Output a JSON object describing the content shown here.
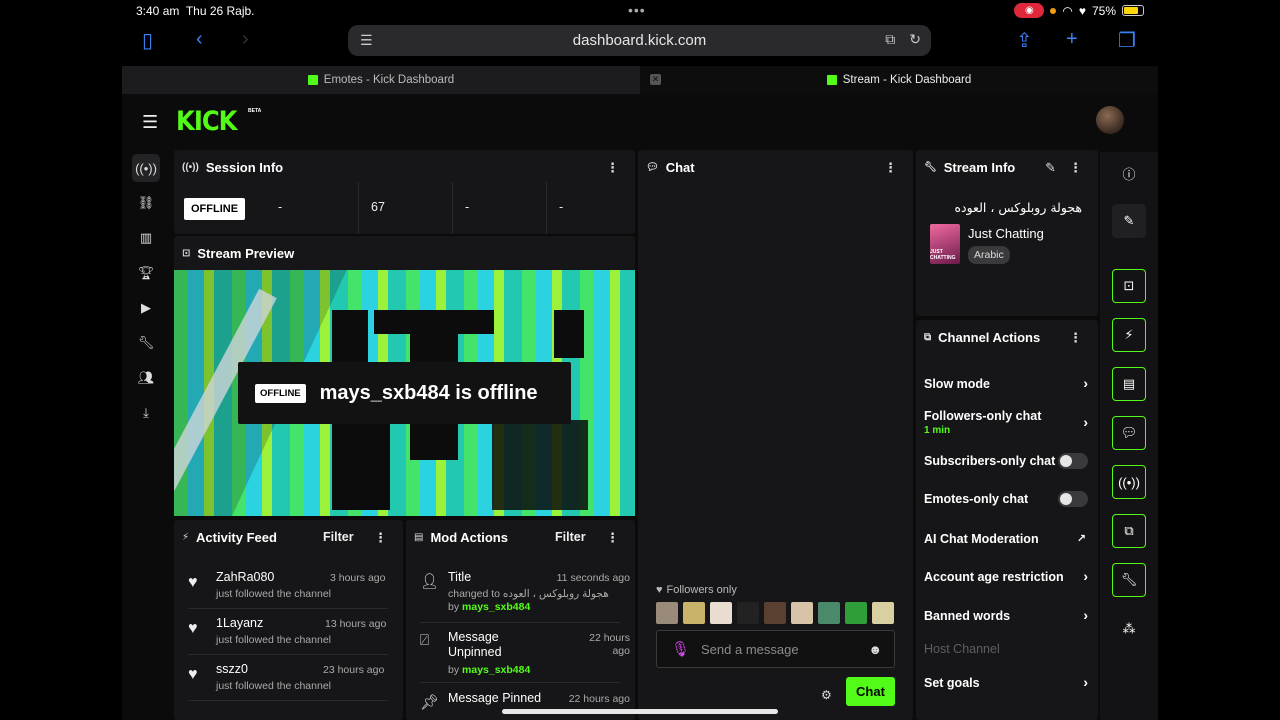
{
  "status_bar": {
    "time": "3:40 am",
    "date": "Thu 26 Rajb.",
    "battery": "75%",
    "battery_level": 0.75
  },
  "browser": {
    "url": "dashboard.kick.com",
    "tabs": [
      {
        "title": "Emotes - Kick Dashboard",
        "active": false
      },
      {
        "title": "Stream - Kick Dashboard",
        "active": true
      }
    ]
  },
  "header": {
    "logo": "KICK",
    "beta": "BETA"
  },
  "session_info": {
    "title": "Session Info",
    "status": "OFFLINE",
    "stats": [
      "-",
      "67",
      "-",
      "-"
    ]
  },
  "stream_preview": {
    "title": "Stream Preview",
    "badge": "OFFLINE",
    "message": "mays_sxb484 is offline"
  },
  "activity_feed": {
    "title": "Activity Feed",
    "filter": "Filter",
    "items": [
      {
        "name": "ZahRa080",
        "time": "3 hours ago",
        "sub": "just followed the channel"
      },
      {
        "name": "1Layanz",
        "time": "13 hours ago",
        "sub": "just followed the channel"
      },
      {
        "name": "sszz0",
        "time": "23 hours ago",
        "sub": "just followed the channel"
      }
    ]
  },
  "mod_actions": {
    "title": "Mod Actions",
    "filter": "Filter",
    "items": [
      {
        "title": "Title",
        "time": "11 seconds ago",
        "sub": "changed to هجولة روبلوكس ، العوده",
        "by_label": "by",
        "by": "mays_sxb484"
      },
      {
        "title": "Message Unpinned",
        "time": "22 hours ago",
        "by_label": "by",
        "by": "mays_sxb484"
      },
      {
        "title": "Message Pinned",
        "time": "22 hours ago"
      }
    ]
  },
  "chat": {
    "title": "Chat",
    "followers_only": "Followers only",
    "placeholder": "Send a message",
    "send": "Chat"
  },
  "stream_info": {
    "title": "Stream Info",
    "stream_title": "هجولة روبلوكس ، العوده",
    "category": "Just Chatting",
    "category_art": "JUST CHATTING",
    "language": "Arabic"
  },
  "channel_actions": {
    "title": "Channel Actions",
    "items": [
      {
        "label": "Slow mode",
        "control": "chevron"
      },
      {
        "label": "Followers-only chat",
        "sub": "1 min",
        "control": "chevron"
      },
      {
        "label": "Subscribers-only chat",
        "control": "toggle"
      },
      {
        "label": "Emotes-only chat",
        "control": "toggle"
      },
      {
        "label": "AI Chat Moderation",
        "control": "external"
      },
      {
        "label": "Account age restriction",
        "control": "chevron"
      },
      {
        "label": "Banned words",
        "control": "chevron"
      },
      {
        "label": "Host Channel",
        "control": "none"
      },
      {
        "label": "Set goals",
        "control": "chevron"
      }
    ]
  },
  "colors": {
    "accent": "#53fc18",
    "background": "#0b0b0c",
    "panel": "#161618"
  }
}
